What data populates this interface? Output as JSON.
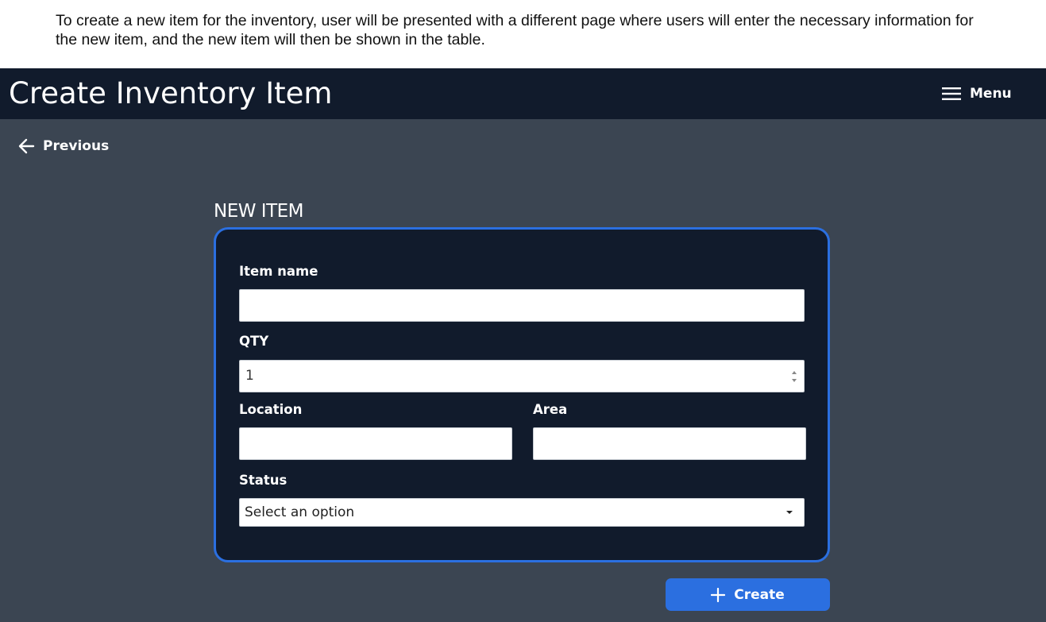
{
  "caption": {
    "text": "To create a new item for the inventory, user will be presented with a different page where users will enter the necessary information for the new item, and the new item will then be shown in the table."
  },
  "header": {
    "title": "Create Inventory Item",
    "menu_label": "Menu",
    "menu_icon": "hamburger-icon"
  },
  "nav": {
    "back_label": "Previous",
    "back_icon": "arrow-left-icon"
  },
  "form": {
    "section_title": "NEW ITEM",
    "item_name": {
      "label": "Item name",
      "value": ""
    },
    "qty": {
      "label": "QTY",
      "value": "1"
    },
    "location": {
      "label": "Location",
      "value": ""
    },
    "area": {
      "label": "Area",
      "value": ""
    },
    "status": {
      "label": "Status",
      "selected": "Select an option"
    },
    "submit_label": "Create",
    "submit_icon": "plus-icon"
  },
  "colors": {
    "header_bg": "#111b2c",
    "page_bg": "#3b4552",
    "card_bg": "#111b2c",
    "accent": "#2b6fe0",
    "text": "#ffffff"
  }
}
